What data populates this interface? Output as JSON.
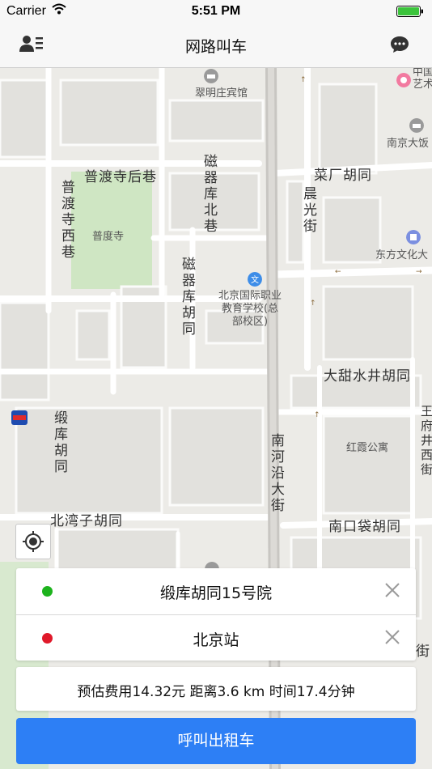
{
  "status_bar": {
    "carrier": "Carrier",
    "time": "5:51 PM"
  },
  "nav": {
    "title": "网路叫车"
  },
  "map": {
    "labels": {
      "hotel": "翠明庄宾馆",
      "china_art": "中国\n艺术",
      "nanjing_hotel": "南京大饭",
      "pudusi_hou": "普渡寺后巷",
      "pudusi_xi": "普渡寺西巷",
      "pudusi": "普度寺",
      "ciqiku_bei": "磁器库北巷",
      "ciqiku_hutong": "磁器库胡同",
      "caichang": "菜厂胡同",
      "chenguang": "晨光街",
      "dongfang": "东方文化大",
      "school": "北京国际职业\n教育学校(总\n部校区)",
      "datianshui": "大甜水井胡同",
      "duanku": "缎库胡同",
      "hongxia": "红霞公寓",
      "nanhe": "南河沿大街",
      "wangfujing_xi": "王府井西街",
      "beiwanzi": "北湾子胡同",
      "nankoudai": "南口袋胡同",
      "street_bottom": "街"
    }
  },
  "route": {
    "from": "缎库胡同15号院",
    "to": "北京站",
    "from_color": "#1db31d",
    "to_color": "#e0192a"
  },
  "fare": {
    "summary": "预估费用14.32元  距离3.6 km  时间17.4分钟"
  },
  "call_button": {
    "label": "呼叫出租车"
  },
  "colors": {
    "accent": "#2d7ff5",
    "map_bg": "#ecebe7",
    "park": "#cfe6c3"
  }
}
